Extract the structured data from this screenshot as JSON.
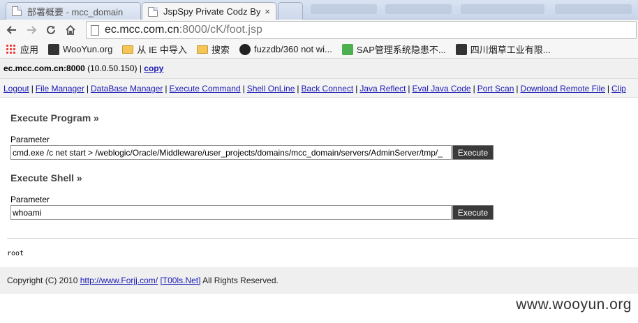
{
  "browser": {
    "tabs": [
      {
        "title": "部署概要 - mcc_domain"
      },
      {
        "title": "JspSpy Private Codz By",
        "active": true
      }
    ],
    "tab_close_glyph": "×",
    "url_host": "ec.mcc.com.cn",
    "url_rest": ":8000/cK/foot.jsp",
    "bookmarks": [
      {
        "label": "应用",
        "icon": "apps-icon"
      },
      {
        "label": "WooYun.org",
        "icon": "wooyun-icon"
      },
      {
        "label": "从 IE 中导入",
        "icon": "folder-icon"
      },
      {
        "label": "搜索",
        "icon": "folder-icon"
      },
      {
        "label": "fuzzdb/360 not wi...",
        "icon": "github-icon"
      },
      {
        "label": "SAP管理系统隐患不...",
        "icon": "sap-icon"
      },
      {
        "label": "四川烟草工业有限...",
        "icon": "bookmark-page-icon"
      }
    ]
  },
  "hostbar": {
    "host": "ec.mcc.com.cn:8000",
    "ip": "(10.0.50.150)",
    "sep": "|",
    "copy_label": "copy"
  },
  "menu": [
    "Logout",
    "File Manager",
    "DataBase Manager",
    "Execute Command",
    "Shell OnLine",
    "Back Connect",
    "Java Reflect",
    "Eval Java Code",
    "Port Scan",
    "Download Remote File",
    "Clip"
  ],
  "menu_sep": "|",
  "execute_program": {
    "title": "Execute Program »",
    "param_label": "Parameter",
    "value": "cmd.exe /c net start > /weblogic/Oracle/Middleware/user_projects/domains/mcc_domain/servers/AdminServer/tmp/_",
    "button": "Execute"
  },
  "execute_shell": {
    "title": "Execute Shell »",
    "param_label": "Parameter",
    "value": "whoami",
    "button": "Execute"
  },
  "output": "root",
  "footer": {
    "text1": "Copyright (C) 2010",
    "link1": "http://www.Forjj.com/",
    "link2": "[T00ls.Net]",
    "text2": "All Rights Reserved."
  },
  "watermark": "www.wooyun.org"
}
